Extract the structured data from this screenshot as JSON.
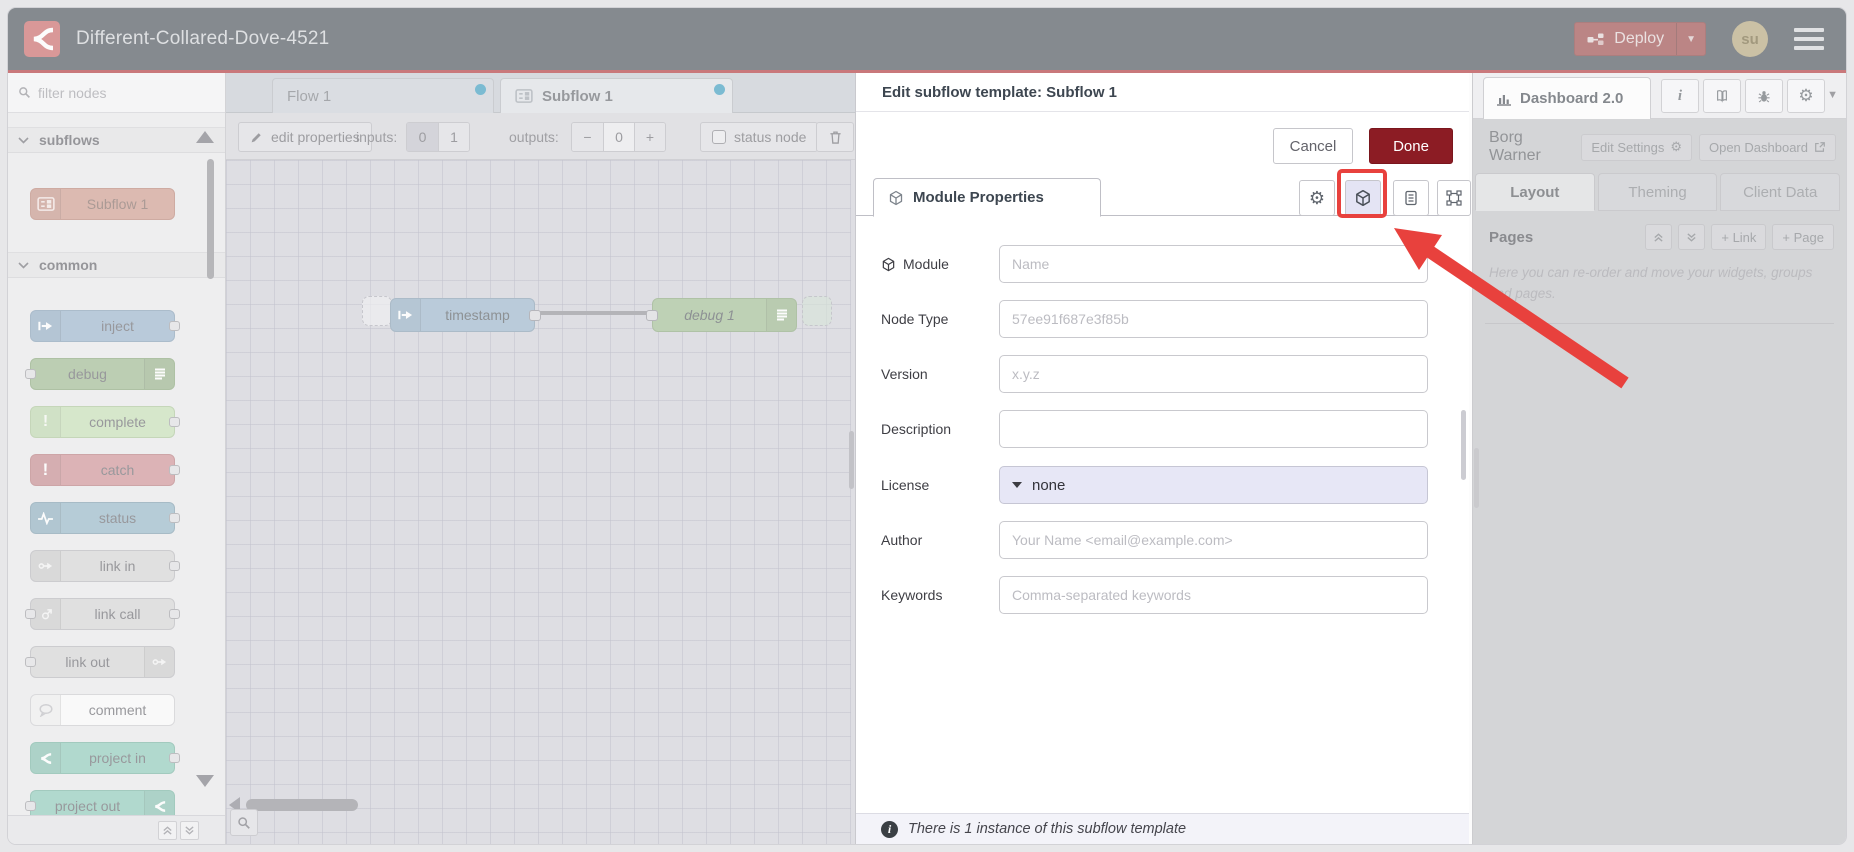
{
  "header": {
    "title": "Different-Collared-Dove-4521",
    "deploy_label": "Deploy",
    "avatar_initials": "su"
  },
  "palette": {
    "filter_placeholder": "filter nodes",
    "categories": [
      {
        "label": "subflows",
        "nodes": [
          {
            "label": "Subflow 1"
          }
        ]
      },
      {
        "label": "common",
        "nodes": [
          {
            "label": "inject"
          },
          {
            "label": "debug"
          },
          {
            "label": "complete"
          },
          {
            "label": "catch"
          },
          {
            "label": "status"
          },
          {
            "label": "link in"
          },
          {
            "label": "link call"
          },
          {
            "label": "link out"
          },
          {
            "label": "comment"
          },
          {
            "label": "project in"
          },
          {
            "label": "project out"
          }
        ]
      }
    ]
  },
  "workspace": {
    "tabs": [
      {
        "label": "Flow 1"
      },
      {
        "label": "Subflow 1"
      }
    ],
    "toolbar": {
      "edit_properties": "edit properties",
      "inputs_label": "inputs:",
      "input_options": [
        "0",
        "1"
      ],
      "outputs_label": "outputs:",
      "outputs_minus": "−",
      "outputs_value": "0",
      "outputs_plus": "+",
      "status_node": "status node"
    },
    "nodes": [
      {
        "label": "timestamp"
      },
      {
        "label": "debug 1"
      }
    ]
  },
  "dialog": {
    "title": "Edit subflow template: Subflow 1",
    "cancel_label": "Cancel",
    "done_label": "Done",
    "tab_label": "Module Properties",
    "fields": [
      {
        "label": "Module",
        "placeholder": "Name"
      },
      {
        "label": "Node Type",
        "placeholder": "57ee91f687e3f85b"
      },
      {
        "label": "Version",
        "placeholder": "x.y.z"
      },
      {
        "label": "Description",
        "placeholder": ""
      },
      {
        "label": "License",
        "value": "none"
      },
      {
        "label": "Author",
        "placeholder": "Your Name <email@example.com>"
      },
      {
        "label": "Keywords",
        "placeholder": "Comma-separated keywords"
      }
    ],
    "footer_text": "There is 1 instance of this subflow template"
  },
  "sidebar": {
    "tab_label": "Dashboard 2.0",
    "project_name": "Borg Warner",
    "edit_settings_label": "Edit Settings",
    "open_dashboard_label": "Open Dashboard",
    "tabs": [
      {
        "label": "Layout"
      },
      {
        "label": "Theming"
      },
      {
        "label": "Client Data"
      }
    ],
    "pages_title": "Pages",
    "link_button": "+ Link",
    "page_button": "+ Page",
    "help_text": "Here you can re-order and move your widgets, groups and pages."
  },
  "colors": {
    "accent_red": "#8c1c24",
    "annotation_red": "#e8413d",
    "tab_dot_blue": "#2f96bc",
    "header_bg": "#3f474f"
  }
}
